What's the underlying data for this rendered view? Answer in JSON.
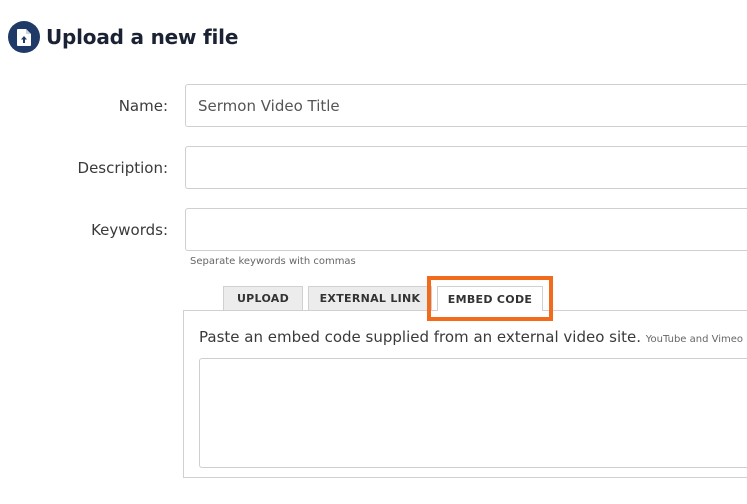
{
  "header": {
    "title": "Upload a new file",
    "icon": "file-upload-icon"
  },
  "form": {
    "name": {
      "label": "Name:",
      "value": "Sermon Video Title"
    },
    "description": {
      "label": "Description:",
      "value": ""
    },
    "keywords": {
      "label": "Keywords:",
      "value": "",
      "help": "Separate keywords with commas"
    }
  },
  "tabs": [
    {
      "label": "UPLOAD"
    },
    {
      "label": "EXTERNAL LINK"
    },
    {
      "label": "EMBED CODE",
      "active": true
    }
  ],
  "embed_panel": {
    "instruction": "Paste an embed code supplied from an external video site.",
    "note": "YouTube and Vimeo URLs"
  },
  "colors": {
    "highlight": "#f26a1b",
    "icon_bg": "#1f3a66"
  }
}
